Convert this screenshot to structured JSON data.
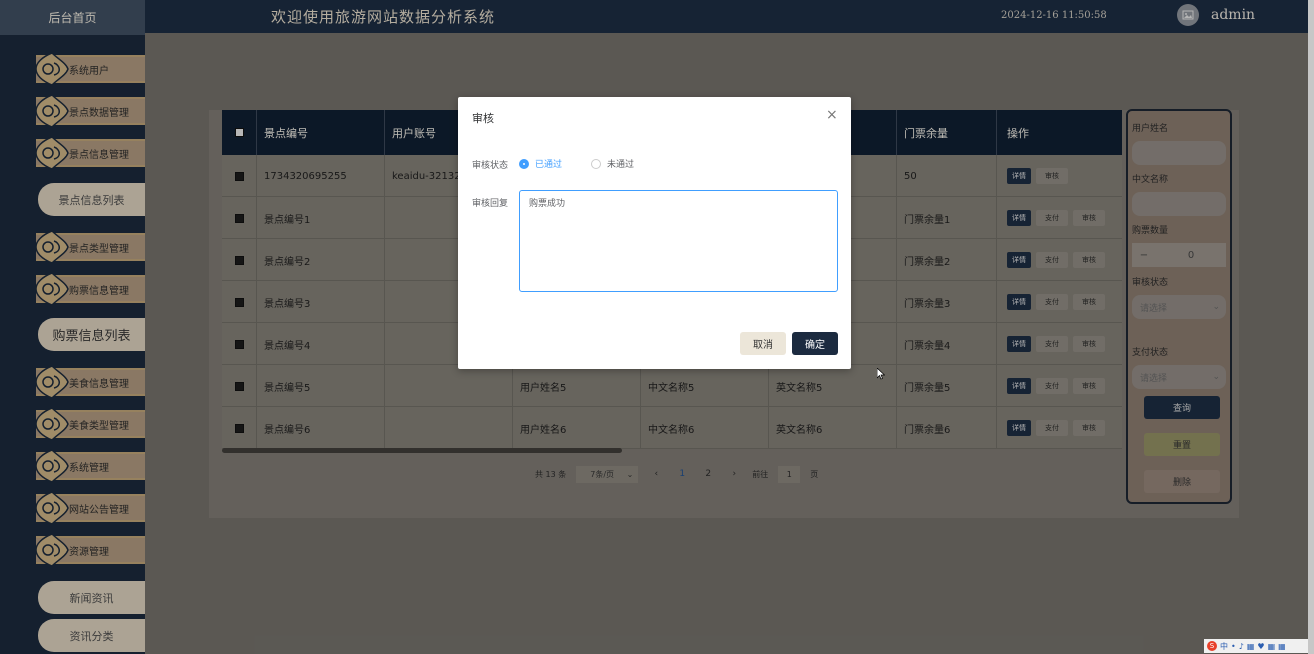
{
  "header": {
    "home_label": "后台首页",
    "system_title": "欢迎使用旅游网站数据分析系统",
    "datetime": "2024-12-16 11:50:58",
    "username": "admin"
  },
  "sidebar": {
    "items": [
      {
        "label": "系统用户",
        "type": "group"
      },
      {
        "label": "景点数据管理",
        "type": "group"
      },
      {
        "label": "景点信息管理",
        "type": "group"
      },
      {
        "label": "景点信息列表",
        "type": "sub"
      },
      {
        "label": "景点类型管理",
        "type": "group"
      },
      {
        "label": "购票信息管理",
        "type": "group"
      },
      {
        "label": "购票信息列表",
        "type": "sub_active"
      },
      {
        "label": "美食信息管理",
        "type": "group"
      },
      {
        "label": "美食类型管理",
        "type": "group"
      },
      {
        "label": "系统管理",
        "type": "group"
      },
      {
        "label": "网站公告管理",
        "type": "group"
      },
      {
        "label": "资源管理",
        "type": "group"
      },
      {
        "label": "新闻资讯",
        "type": "sub"
      },
      {
        "label": "资讯分类",
        "type": "sub"
      }
    ]
  },
  "table": {
    "headers": [
      "景点编号",
      "用户账号",
      "",
      "",
      "",
      "门票余量",
      "操作"
    ],
    "rows": [
      {
        "c1": "1734320695255",
        "c2": "keaidu-321321",
        "c3": "",
        "c4": "",
        "c5": "",
        "c6": "50",
        "actions": [
          "详情",
          "审核"
        ]
      },
      {
        "c1": "景点编号1",
        "c2": "",
        "c3": "",
        "c4": "",
        "c5": "",
        "c6": "门票余量1",
        "actions": [
          "详情",
          "支付",
          "审核"
        ]
      },
      {
        "c1": "景点编号2",
        "c2": "",
        "c3": "",
        "c4": "",
        "c5": "",
        "c6": "门票余量2",
        "actions": [
          "详情",
          "支付",
          "审核"
        ]
      },
      {
        "c1": "景点编号3",
        "c2": "",
        "c3": "",
        "c4": "",
        "c5": "",
        "c6": "门票余量3",
        "actions": [
          "详情",
          "支付",
          "审核"
        ]
      },
      {
        "c1": "景点编号4",
        "c2": "",
        "c3": "",
        "c4": "",
        "c5": "",
        "c6": "门票余量4",
        "actions": [
          "详情",
          "支付",
          "审核"
        ]
      },
      {
        "c1": "景点编号5",
        "c2": "",
        "c3": "用户姓名5",
        "c4": "中文名称5",
        "c5": "英文名称5",
        "c6": "门票余量5",
        "actions": [
          "详情",
          "支付",
          "审核"
        ]
      },
      {
        "c1": "景点编号6",
        "c2": "",
        "c3": "用户姓名6",
        "c4": "中文名称6",
        "c5": "英文名称6",
        "c6": "门票余量6",
        "actions": [
          "详情",
          "支付",
          "审核"
        ]
      }
    ]
  },
  "pagination": {
    "total": "共 13 条",
    "page_size": "7条/页",
    "pages": [
      "1",
      "2"
    ],
    "current_page": "1",
    "goto_label": "前往",
    "goto_value": "1",
    "page_suffix": "页"
  },
  "filter": {
    "user_name_label": "用户姓名",
    "cn_name_label": "中文名称",
    "quantity_label": "购票数量",
    "quantity_value": "0",
    "review_status_label": "审核状态",
    "review_status_placeholder": "请选择",
    "pay_status_label": "支付状态",
    "pay_status_placeholder": "请选择",
    "query_button": "查询",
    "reset_button": "重置",
    "delete_button": "删除"
  },
  "dialog": {
    "title": "审核",
    "status_label": "审核状态",
    "option_pass": "已通过",
    "option_fail": "未通过",
    "selected": "已通过",
    "reply_label": "审核回复",
    "reply_value": "购票成功",
    "cancel_button": "取消",
    "ok_button": "确定"
  },
  "colors": {
    "header_bg": "#1c2b40",
    "accent_blue": "#409eff",
    "primary_button": "#1c2b40",
    "sidebar_gold": "#b89e73"
  }
}
